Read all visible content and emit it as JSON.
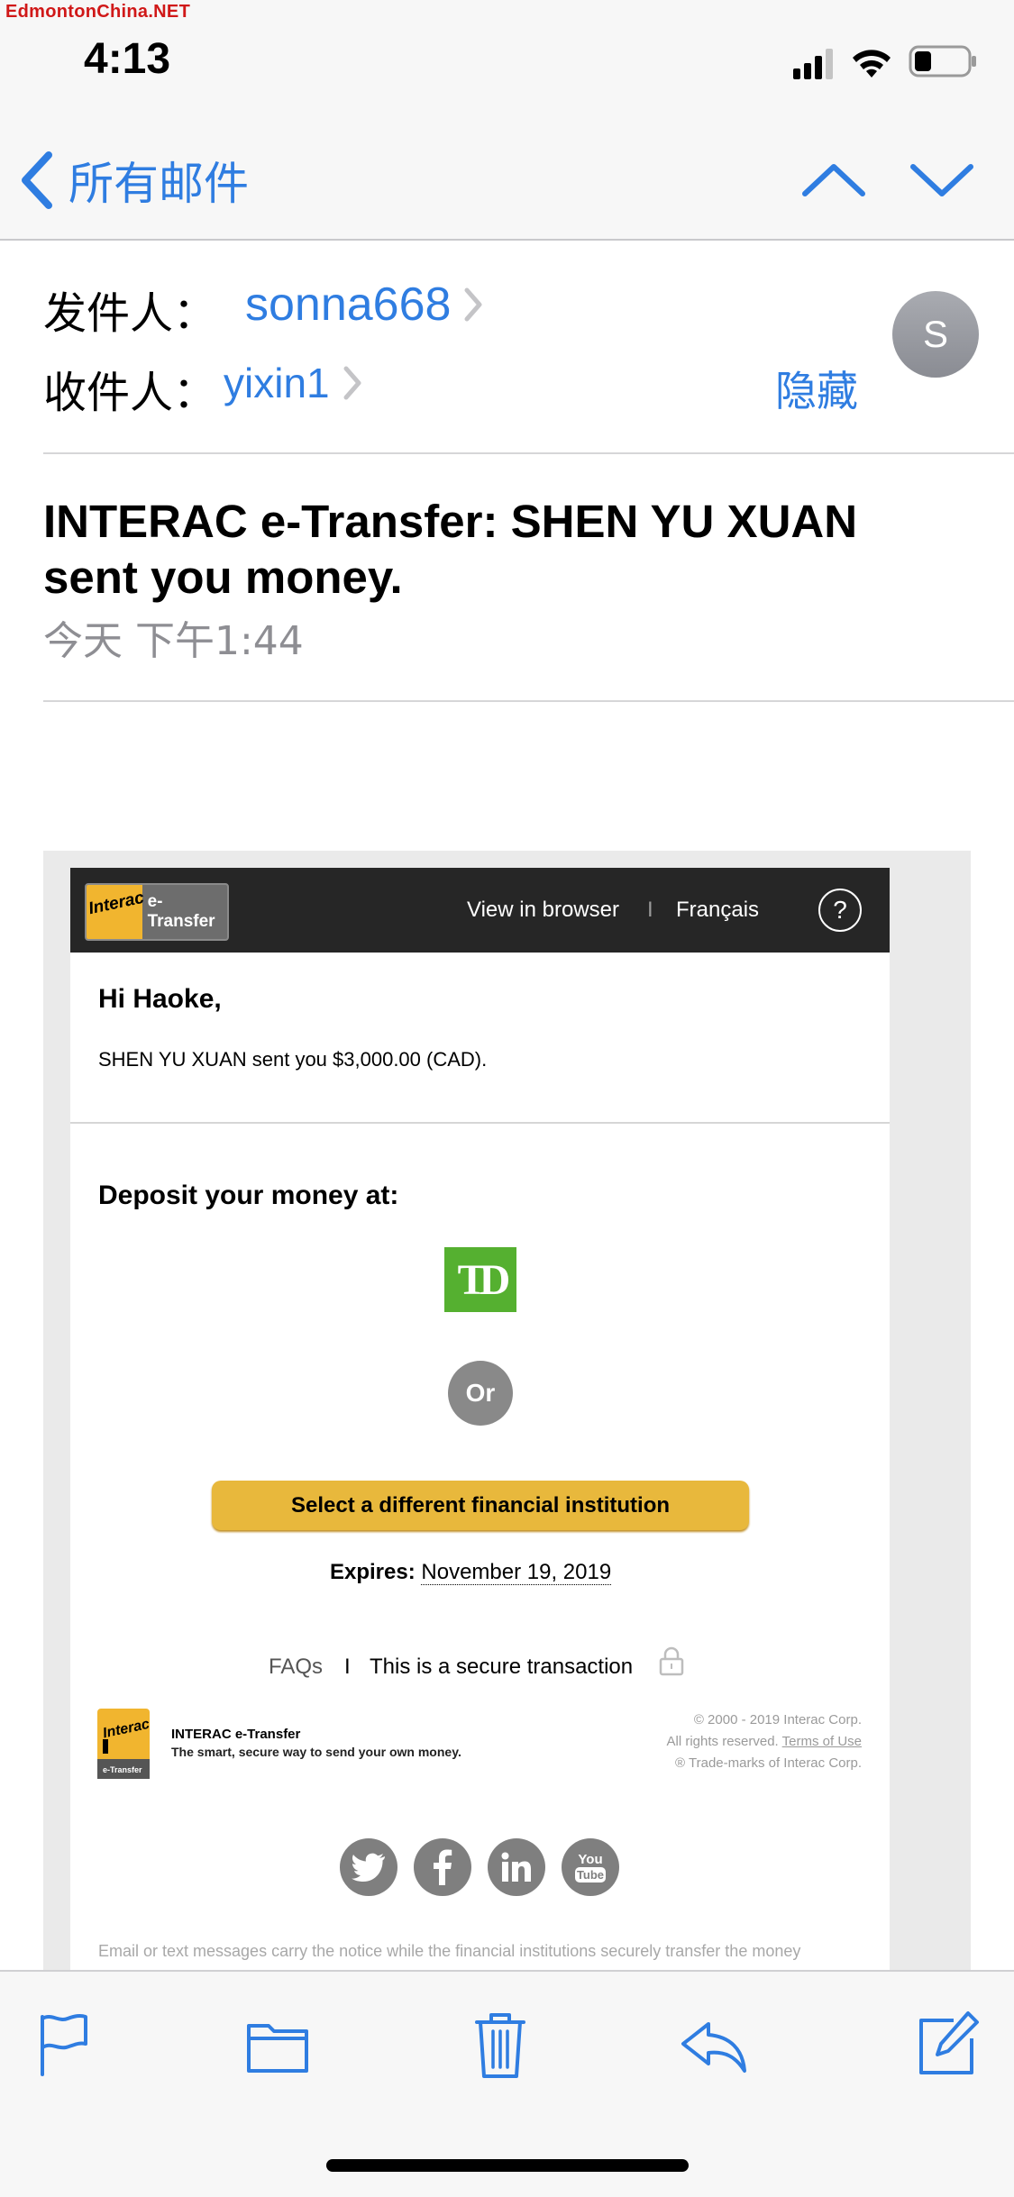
{
  "watermark": "EdmontonChina.NET",
  "status_bar": {
    "time": "4:13"
  },
  "nav": {
    "back_label": "所有邮件",
    "icons": [
      "back-chevron-icon",
      "up-arrow-icon",
      "down-arrow-icon"
    ]
  },
  "header": {
    "from_label": "发件人：",
    "from_name": "sonna668",
    "to_label": "收件人：",
    "to_name": "yixin1",
    "hide_label": "隐藏",
    "avatar_initial": "S"
  },
  "subject": "INTERAC e-Transfer: SHEN YU XUAN sent you money.",
  "date": "今天 下午1:44",
  "email": {
    "logo_word": "Interac",
    "logo_product": "e-Transfer",
    "view_in_browser": "View in browser",
    "separator": "I",
    "francais": "Français",
    "help": "?",
    "greeting": "Hi Haoke,",
    "sent_line": "SHEN YU XUAN sent you $3,000.00 (CAD).",
    "deposit_title": "Deposit your money at:",
    "bank_logo": "TD",
    "or_label": "Or",
    "select_button": "Select a different financial institution",
    "expires_label": "Expires:",
    "expires_date": "November 19, 2019",
    "faqs": "FAQs",
    "footer_sep": "I",
    "secure_text": "This is a secure transaction",
    "footer_brand": "INTERAC e-Transfer",
    "footer_tagline": "The smart, secure way to send your own money.",
    "legal_copyright": "© 2000 - 2019 Interac Corp.",
    "legal_rights": "All rights reserved.",
    "legal_terms": "Terms of Use",
    "legal_trademark": "® Trade-marks of Interac Corp.",
    "social": [
      "twitter-icon",
      "facebook-icon",
      "linkedin-icon",
      "youtube-icon"
    ],
    "youtube_text_top": "You",
    "youtube_text_bottom": "Tube",
    "disclaimer": "Email or text messages carry the notice while the financial institutions securely transfer the money"
  },
  "toolbar": {
    "icons": [
      "flag-icon",
      "folder-icon",
      "trash-icon",
      "reply-icon",
      "compose-icon"
    ]
  },
  "colors": {
    "ios_blue": "#2f7de1",
    "interac_yellow": "#f1b52f",
    "td_green": "#55b030",
    "button_yellow": "#e8b83c"
  }
}
